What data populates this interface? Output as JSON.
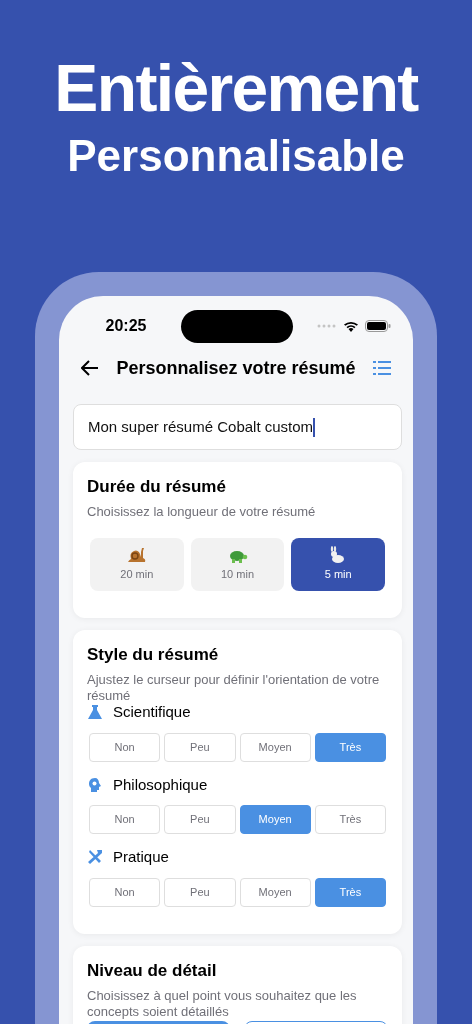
{
  "headline": {
    "line_1": "Entièrement",
    "line_2": "Personnalisable"
  },
  "status_bar": {
    "time": "20:25"
  },
  "nav": {
    "title": "Personnalisez votre résumé"
  },
  "name_field": {
    "value": "Mon super résumé Cobalt custom"
  },
  "duration": {
    "title": "Durée du résumé",
    "subtitle": "Choisissez la longueur de votre résumé",
    "options": [
      {
        "label": "20 min",
        "selected": false
      },
      {
        "label": "10 min",
        "selected": false
      },
      {
        "label": "5 min",
        "selected": true
      }
    ]
  },
  "style": {
    "title": "Style du résumé",
    "subtitle": "Ajustez le curseur pour définir l'orientation de votre résumé",
    "axes": [
      {
        "label": "Scientifique",
        "options": [
          {
            "label": "Non",
            "selected": false
          },
          {
            "label": "Peu",
            "selected": false
          },
          {
            "label": "Moyen",
            "selected": false
          },
          {
            "label": "Très",
            "selected": true
          }
        ]
      },
      {
        "label": "Philosophique",
        "options": [
          {
            "label": "Non",
            "selected": false
          },
          {
            "label": "Peu",
            "selected": false
          },
          {
            "label": "Moyen",
            "selected": true
          },
          {
            "label": "Très",
            "selected": false
          }
        ]
      },
      {
        "label": "Pratique",
        "options": [
          {
            "label": "Non",
            "selected": false
          },
          {
            "label": "Peu",
            "selected": false
          },
          {
            "label": "Moyen",
            "selected": false
          },
          {
            "label": "Très",
            "selected": true
          }
        ]
      }
    ]
  },
  "detail": {
    "title": "Niveau de détail",
    "subtitle": "Choisissez à quel point vous souhaitez que les concepts soient détaillés",
    "options": [
      {
        "selected": true
      },
      {
        "selected": false
      }
    ]
  }
}
